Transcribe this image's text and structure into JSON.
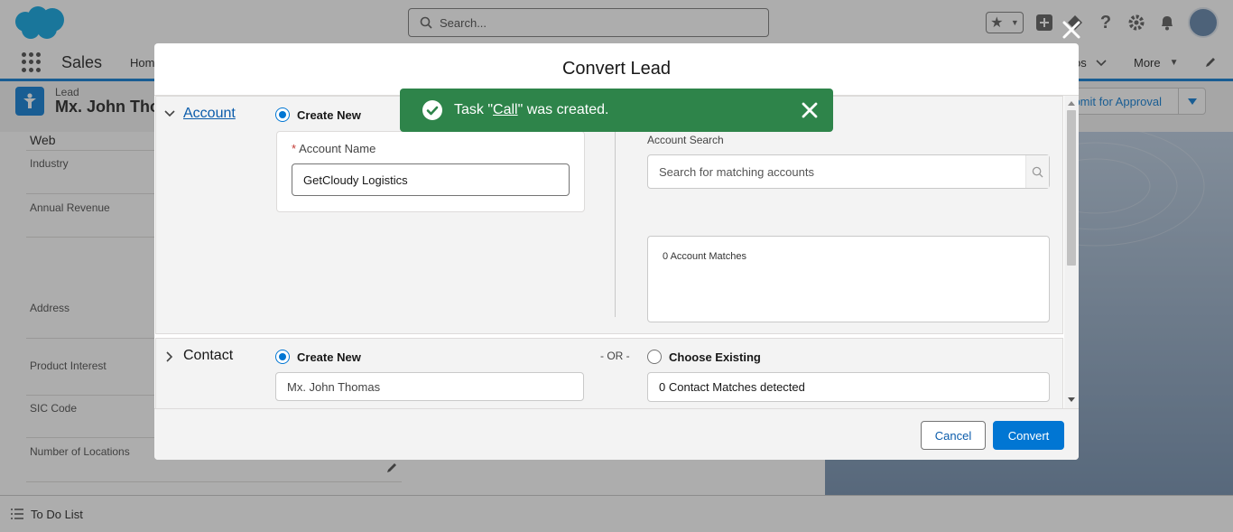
{
  "header": {
    "search_placeholder": "Search...",
    "app_name": "Sales",
    "nav_home": "Home",
    "nav_truncated_tab": "os",
    "nav_more": "More"
  },
  "record": {
    "type": "Lead",
    "name": "Mx. John Thomas",
    "approval_button": "Submit for Approval"
  },
  "details": {
    "web_label": "Web",
    "fields": [
      "Industry",
      "Annual Revenue",
      "Address",
      "Product Interest",
      "SIC Code",
      "Number of Locations"
    ]
  },
  "footer": {
    "todo": "To Do List"
  },
  "modal": {
    "title": "Convert Lead",
    "account": {
      "section_label": "Account",
      "create_new": "Create New",
      "name_label": "Account Name",
      "name_value": "GetCloudy Logistics",
      "search_label": "Account Search",
      "search_placeholder": "Search for matching accounts",
      "matches": "0 Account Matches"
    },
    "contact": {
      "section_label": "Contact",
      "create_new": "Create New",
      "or": "- OR -",
      "choose_existing": "Choose Existing",
      "name_value": "Mx. John Thomas",
      "matches": "0 Contact Matches detected"
    },
    "cancel": "Cancel",
    "convert": "Convert"
  },
  "toast": {
    "prefix": "Task \"",
    "link": "Call",
    "suffix": "\" was created.",
    "color": "#2e844a"
  },
  "colors": {
    "brand": "#0176d3",
    "success": "#2e844a"
  },
  "icons": [
    "salesforce-cloud-logo",
    "search-icon",
    "favorites-star-icon",
    "add-icon",
    "trailhead-icon",
    "help-icon",
    "setup-gear-icon",
    "notifications-bell-icon",
    "avatar",
    "app-launcher-icon",
    "chevron-down-icon",
    "edit-pencil-icon",
    "lead-icon",
    "todo-list-icon",
    "close-icon",
    "success-check-icon"
  ]
}
